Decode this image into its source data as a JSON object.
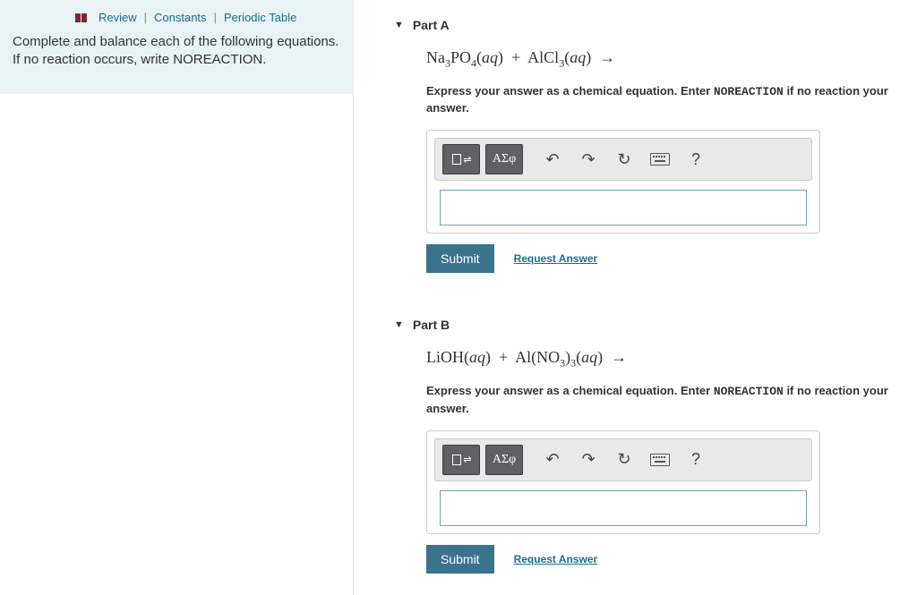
{
  "sidebar": {
    "links": {
      "review": "Review",
      "constants": "Constants",
      "periodic": "Periodic Table"
    },
    "instructions": "Complete and balance each of the following equations. If no reaction occurs, write NOREACTION."
  },
  "parts": {
    "a": {
      "title": "Part A",
      "equation_html": "Na<span class='sub'>3</span>PO<span class='sub'>4</span>(<span class='phase'>aq</span>) &nbsp;+&nbsp; AlCl<span class='sub'>3</span>(<span class='phase'>aq</span>) &nbsp;→",
      "instr_prefix": "Express your answer as a chemical equation. Enter ",
      "instr_mono": "NOREACTION",
      "instr_suffix": " if no reaction your answer.",
      "symbols_label": "ΑΣφ",
      "help_label": "?",
      "submit": "Submit",
      "request": "Request Answer"
    },
    "b": {
      "title": "Part B",
      "equation_html": "LiOH(<span class='phase'>aq</span>) &nbsp;+&nbsp; Al(NO<span class='sub'>3</span>)<span class='sub'>3</span>(<span class='phase'>aq</span>) &nbsp;→",
      "instr_prefix": "Express your answer as a chemical equation. Enter ",
      "instr_mono": "NOREACTION",
      "instr_suffix": " if no reaction your answer.",
      "symbols_label": "ΑΣφ",
      "help_label": "?",
      "submit": "Submit",
      "request": "Request Answer"
    }
  }
}
